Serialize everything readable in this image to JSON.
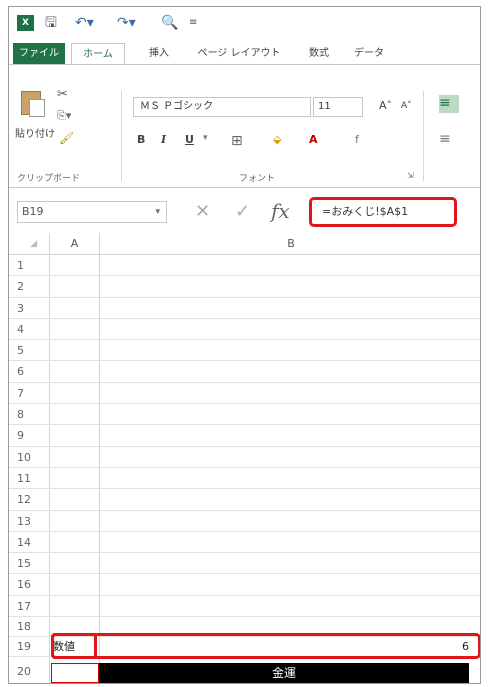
{
  "qat": {
    "logo": "X",
    "save_icon": "save-icon",
    "undo_icon": "undo-icon",
    "redo_icon": "redo-icon",
    "preview_icon": "print-preview-icon",
    "more_icon": "customize-icon"
  },
  "tabs": [
    "ファイル",
    "ホーム",
    "挿入",
    "ページ レイアウト",
    "数式",
    "データ"
  ],
  "ribbon": {
    "paste_label": "貼り付け",
    "clipboard_label": "クリップボード",
    "font_label": "フォント",
    "font_name": "ＭＳ Ｐゴシック",
    "font_size": "11",
    "bold": "B",
    "italic": "I",
    "underline": "U"
  },
  "formula_bar": {
    "name_box": "B19",
    "formula": "=おみくじ!$A$1"
  },
  "grid": {
    "col_a": "A",
    "col_b": "B",
    "row_numbers": [
      "1",
      "2",
      "3",
      "4",
      "5",
      "6",
      "7",
      "8",
      "9",
      "10",
      "11",
      "12",
      "13",
      "14",
      "15",
      "16",
      "17",
      "18",
      "19",
      "20"
    ],
    "a19": "数値",
    "b19": "6",
    "b20": "金運"
  },
  "colors": {
    "accent": "#217346",
    "highlight_border": "#e0161a"
  }
}
